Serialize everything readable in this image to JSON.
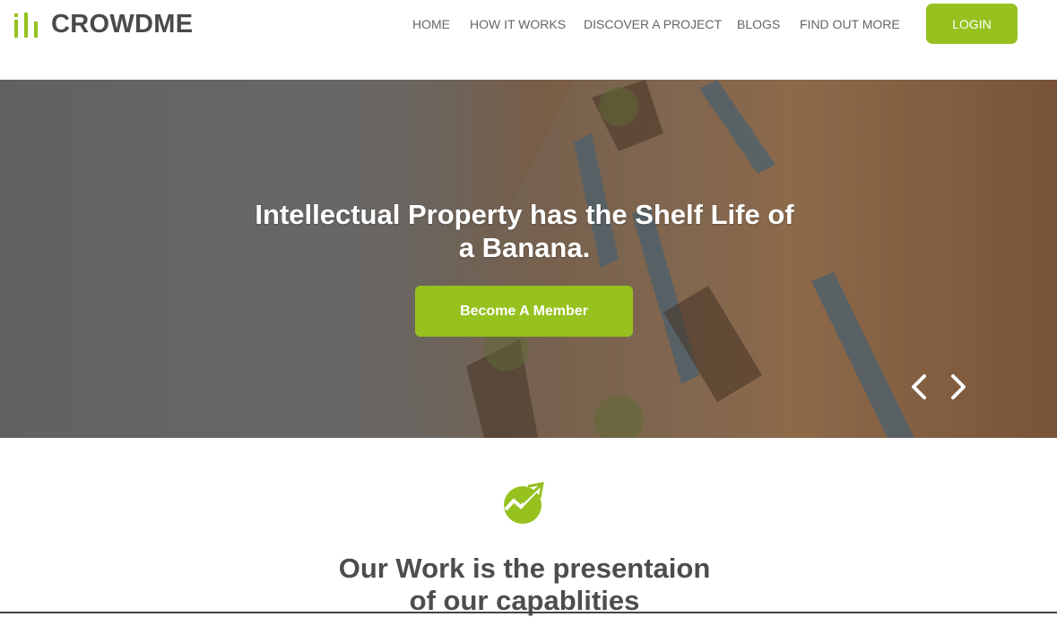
{
  "brand": {
    "name": "CROWDME",
    "accent": "#96c11f"
  },
  "nav": {
    "items": [
      {
        "label": "HOME"
      },
      {
        "label": "HOW IT WORKS"
      },
      {
        "label": "DISCOVER A PROJECT"
      },
      {
        "label": "BLOGS"
      },
      {
        "label": "FIND OUT MORE"
      }
    ],
    "login_label": "LOGIN"
  },
  "hero": {
    "title_line1": "Intellectual Property has the Shelf Life of",
    "title_line2": "a Banana.",
    "cta_label": "Become A Member",
    "prev_icon": "chevron-left-icon",
    "next_icon": "chevron-right-icon"
  },
  "section": {
    "icon": "growth-chart-icon",
    "title_line1": "Our Work is the presentaion",
    "title_line2": "of our capablities"
  }
}
